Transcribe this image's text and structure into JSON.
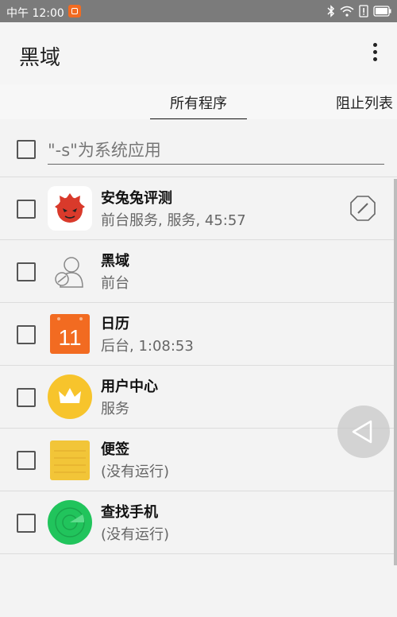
{
  "status_bar": {
    "time": "中午 12:00",
    "icons": [
      "bluetooth-icon",
      "wifi-icon",
      "sim-alert-icon",
      "battery-icon"
    ]
  },
  "app_bar": {
    "title": "黑域",
    "menu_icon": "more-vert-icon"
  },
  "tabs": [
    {
      "label": "所有程序",
      "active": true
    },
    {
      "label": "阻止列表",
      "active": false
    }
  ],
  "filter": {
    "placeholder": "\"-s\"为系统应用",
    "checked": false
  },
  "apps": [
    {
      "name": "安兔兔评测",
      "status": "前台服务, 服务, 45:57",
      "icon": "antutu-icon",
      "has_action": true
    },
    {
      "name": "黑域",
      "status": "前台",
      "icon": "brevent-icon",
      "has_action": false
    },
    {
      "name": "日历",
      "status": "后台, 1:08:53",
      "icon": "calendar-icon",
      "icon_text": "11",
      "has_action": false
    },
    {
      "name": "用户中心",
      "status": "服务",
      "icon": "crown-icon",
      "has_action": false
    },
    {
      "name": "便签",
      "status": "(没有运行)",
      "icon": "notes-icon",
      "has_action": false
    },
    {
      "name": "查找手机",
      "status": "(没有运行)",
      "icon": "radar-icon",
      "has_action": false
    },
    {
      "name": "",
      "status": "",
      "icon": "",
      "has_action": false
    }
  ],
  "colors": {
    "status_bar": "#7b7b7b",
    "antutu_red": "#d93a2b",
    "calendar_orange": "#f26b21",
    "crown_yellow": "#f7c42c",
    "notes_yellow": "#f2c538",
    "radar_green": "#21c45c"
  }
}
